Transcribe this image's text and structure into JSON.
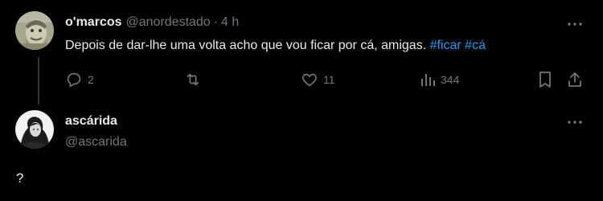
{
  "post": {
    "author_name": "o'marcos",
    "author_handle": "@anordestado",
    "separator": "·",
    "time": "4 h",
    "text": "Depois de dar-lhe uma volta acho que vou ficar por cá, amigas.",
    "hashtags": [
      "#ficar",
      "#cá"
    ],
    "stats": {
      "replies": "2",
      "likes": "11",
      "views": "344"
    },
    "icons": {
      "reply": "reply-icon",
      "retweet": "retweet-icon",
      "like": "like-icon",
      "views": "views-icon",
      "bookmark": "bookmark-icon",
      "share": "share-icon",
      "more": "more-icon"
    }
  },
  "reply": {
    "author_name": "ascárida",
    "author_handle": "@ascarida",
    "text": "?"
  },
  "colors": {
    "background": "#000000",
    "text": "#e7e9ea",
    "muted": "#71767b",
    "accent": "#1d9bf0"
  }
}
